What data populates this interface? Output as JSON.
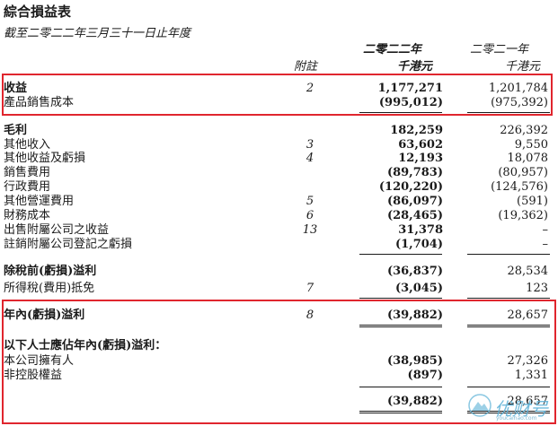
{
  "header": {
    "title": "綜合損益表",
    "subtitle": "截至二零二二年三月三十一日止年度",
    "col_note": "附註",
    "col_current_year": "二零二二年",
    "col_current_unit": "千港元",
    "col_prior_year": "二零二一年",
    "col_prior_unit": "千港元"
  },
  "rows": [
    {
      "label": "收益",
      "note": "2",
      "current": "1,177,271",
      "prior": "1,201,784",
      "bold": true
    },
    {
      "label": "產品銷售成本",
      "note": "",
      "current": "(995,012)",
      "prior": "(975,392)",
      "bold": false
    },
    {
      "label": "毛利",
      "note": "",
      "current": "182,259",
      "prior": "226,392",
      "bold": true
    },
    {
      "label": "其他收入",
      "note": "3",
      "current": "63,602",
      "prior": "9,550",
      "bold": false
    },
    {
      "label": "其他收益及虧損",
      "note": "4",
      "current": "12,193",
      "prior": "18,078",
      "bold": false
    },
    {
      "label": "銷售費用",
      "note": "",
      "current": "(89,783)",
      "prior": "(80,957)",
      "bold": false
    },
    {
      "label": "行政費用",
      "note": "",
      "current": "(120,220)",
      "prior": "(124,576)",
      "bold": false
    },
    {
      "label": "其他營運費用",
      "note": "5",
      "current": "(86,097)",
      "prior": "(591)",
      "bold": false
    },
    {
      "label": "財務成本",
      "note": "6",
      "current": "(28,465)",
      "prior": "(19,362)",
      "bold": false
    },
    {
      "label": "出售附屬公司之收益",
      "note": "13",
      "current": "31,378",
      "prior": "–",
      "bold": false
    },
    {
      "label": "註銷附屬公司登記之虧損",
      "note": "",
      "current": "(1,704)",
      "prior": "–",
      "bold": false
    },
    {
      "label": "除稅前(虧損)溢利",
      "note": "",
      "current": "(36,837)",
      "prior": "28,534",
      "bold": true
    },
    {
      "label": "所得稅(費用)抵免",
      "note": "7",
      "current": "(3,045)",
      "prior": "123",
      "bold": false
    },
    {
      "label": "年內(虧損)溢利",
      "note": "8",
      "current": "(39,882)",
      "prior": "28,657",
      "bold": true
    },
    {
      "label": "以下人士應佔年內(虧損)溢利：",
      "note": "",
      "current": "",
      "prior": "",
      "bold": true
    },
    {
      "label": "本公司擁有人",
      "note": "",
      "current": "(38,985)",
      "prior": "27,326",
      "bold": false
    },
    {
      "label": "非控股權益",
      "note": "",
      "current": "(897)",
      "prior": "1,331",
      "bold": false
    },
    {
      "label": "",
      "note": "",
      "current": "(39,882)",
      "prior": "28,657",
      "bold": false
    }
  ],
  "watermark": {
    "text": "优财号",
    "subtext": "youcaihao.com",
    "icon": "mountain-logo-icon",
    "color": "#5ab0d6"
  },
  "highlight_color": "#e0262e"
}
